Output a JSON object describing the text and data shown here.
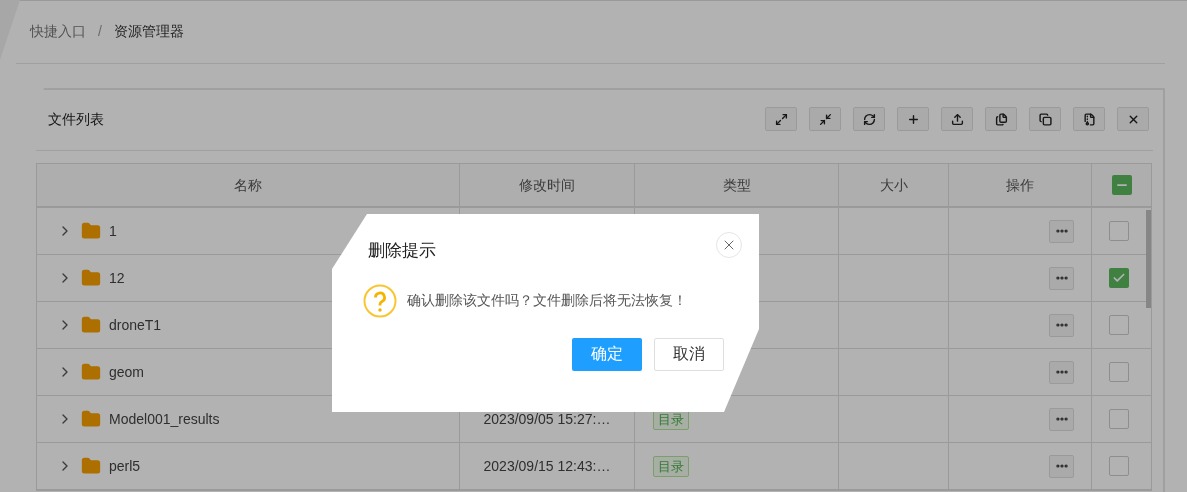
{
  "breadcrumb": [
    {
      "label": "快捷入口",
      "current": false
    },
    {
      "label": "资源管理器",
      "current": true
    }
  ],
  "breadcrumb_separator": "/",
  "panel": {
    "title": "文件列表",
    "toolbar": [
      {
        "kind": "expand"
      },
      {
        "kind": "compress"
      },
      {
        "kind": "refresh"
      },
      {
        "kind": "add"
      },
      {
        "kind": "upload"
      },
      {
        "kind": "paste"
      },
      {
        "kind": "copy"
      },
      {
        "kind": "archive"
      },
      {
        "kind": "delete"
      }
    ]
  },
  "table": {
    "columns": [
      "名称",
      "修改时间",
      "类型",
      "大小",
      "操作"
    ],
    "header_checkbox": {
      "indeterminate": true
    },
    "rows": [
      {
        "name": "1",
        "checked": false
      },
      {
        "name": "12",
        "checked": true
      },
      {
        "name": "droneT1",
        "checked": false
      },
      {
        "name": "geom",
        "checked": false
      },
      {
        "name": "Model001_results",
        "modified": "2023/09/05 15:27:…",
        "type": "目录",
        "checked": false
      },
      {
        "name": "perl5",
        "modified": "2023/09/15 12:43:…",
        "type": "目录",
        "checked": false
      }
    ]
  },
  "dialog": {
    "title": "删除提示",
    "message": "确认删除该文件吗？文件删除后将无法恢复！",
    "buttons": [
      {
        "label": "确定",
        "kind": "primary"
      },
      {
        "label": "取消",
        "kind": "default"
      }
    ]
  }
}
